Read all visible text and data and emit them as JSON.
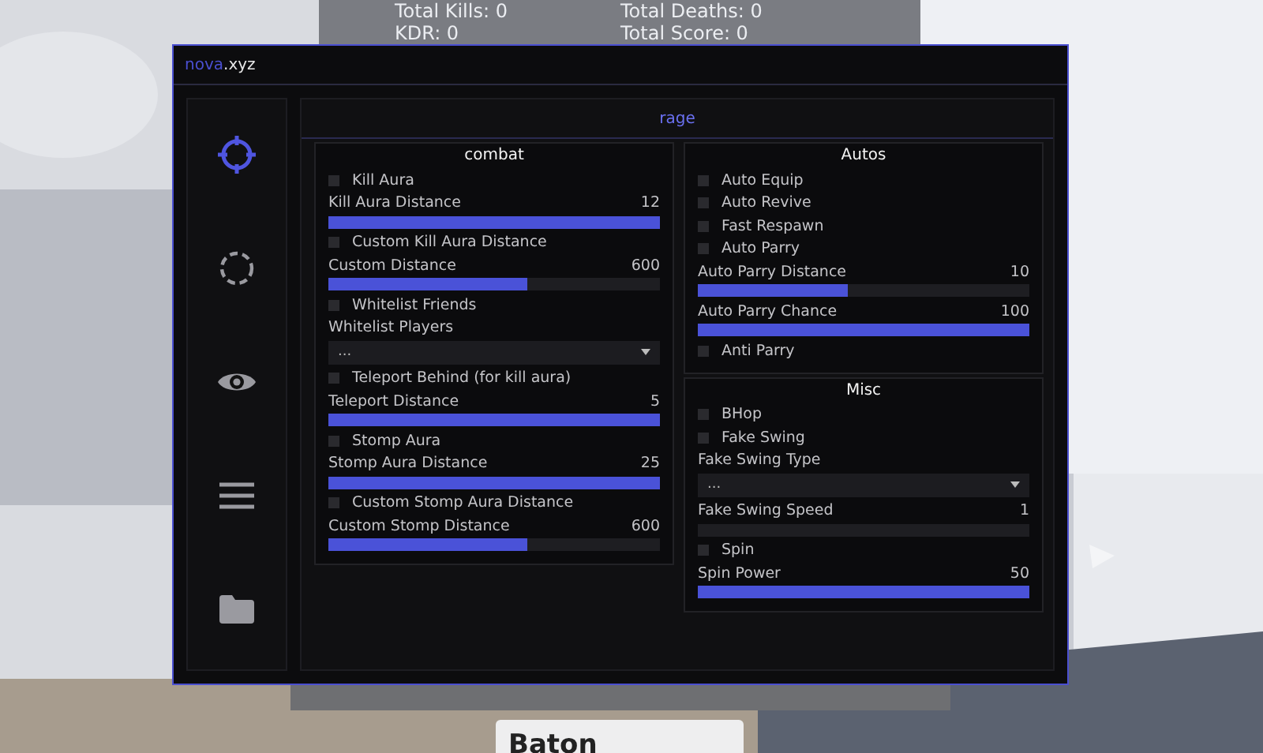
{
  "stats": {
    "total_kills": "Total Kills: 0",
    "total_deaths": "Total Deaths: 0",
    "kdr": "KDR: 0",
    "total_score": "Total Score: 0"
  },
  "window": {
    "title_accent": "nova",
    "title_rest": ".xyz"
  },
  "sidebar": {
    "items": [
      {
        "selected": true
      },
      {
        "selected": false
      },
      {
        "selected": false
      },
      {
        "selected": false
      },
      {
        "selected": false
      }
    ]
  },
  "tab": {
    "label": "rage"
  },
  "sections": [
    {
      "title": "combat",
      "items": [
        {
          "kind": "toggle",
          "label": "Kill Aura",
          "checked": false
        },
        {
          "kind": "slider",
          "label": "Kill Aura Distance",
          "value": "12",
          "level": 1
        },
        {
          "kind": "toggle",
          "label": "Custom Kill Aura Distance",
          "checked": false
        },
        {
          "kind": "slider",
          "label": "Custom Distance",
          "value": "600",
          "level": 0.6
        },
        {
          "kind": "toggle",
          "label": "Whitelist Friends",
          "checked": false
        },
        {
          "kind": "dropdown",
          "label": "Whitelist Players",
          "value": "..."
        },
        {
          "kind": "toggle",
          "label": "Teleport Behind (for kill aura)",
          "checked": false
        },
        {
          "kind": "slider",
          "label": "Teleport Distance",
          "value": "5",
          "level": 1
        },
        {
          "kind": "toggle",
          "label": "Stomp Aura",
          "checked": false
        },
        {
          "kind": "slider",
          "label": "Stomp Aura Distance",
          "value": "25",
          "level": 1
        },
        {
          "kind": "toggle",
          "label": "Custom Stomp Aura Distance",
          "checked": false
        },
        {
          "kind": "slider",
          "label": "Custom Stomp Distance",
          "value": "600",
          "level": 0.6
        }
      ]
    },
    {
      "title": "Autos",
      "items": [
        {
          "kind": "toggle",
          "label": "Auto Equip",
          "checked": false
        },
        {
          "kind": "toggle",
          "label": "Auto Revive",
          "checked": false
        },
        {
          "kind": "toggle",
          "label": "Fast Respawn",
          "checked": false
        },
        {
          "kind": "toggle",
          "label": "Auto Parry",
          "checked": false
        },
        {
          "kind": "slider",
          "label": "Auto Parry Distance",
          "value": "10",
          "level": 0.45
        },
        {
          "kind": "slider",
          "label": "Auto Parry Chance",
          "value": "100",
          "level": 1
        },
        {
          "kind": "toggle",
          "label": "Anti Parry",
          "checked": false
        }
      ]
    },
    {
      "title": "Misc",
      "items": [
        {
          "kind": "toggle",
          "label": "BHop",
          "checked": false
        },
        {
          "kind": "toggle",
          "label": "Fake Swing",
          "checked": false
        },
        {
          "kind": "dropdown",
          "label": "Fake Swing Type",
          "value": "..."
        },
        {
          "kind": "slider",
          "label": "Fake Swing Speed",
          "value": "1",
          "level": 0
        },
        {
          "kind": "toggle",
          "label": "Spin",
          "checked": false
        },
        {
          "kind": "slider",
          "label": "Spin Power",
          "value": "50",
          "level": 1
        }
      ]
    }
  ],
  "hotbar": {
    "item": "Baton"
  }
}
